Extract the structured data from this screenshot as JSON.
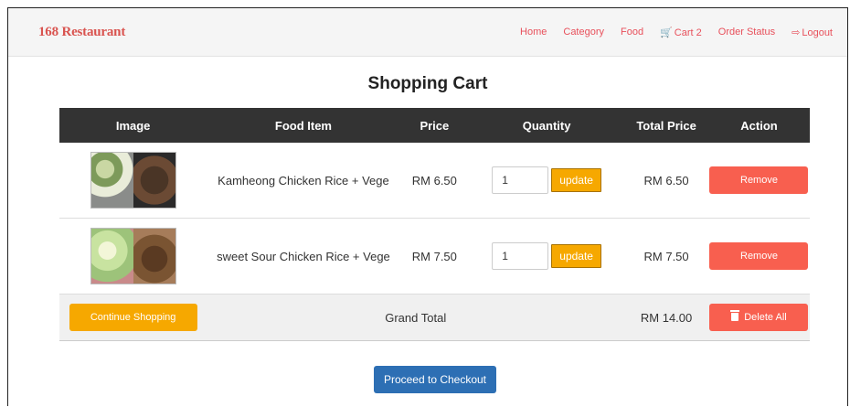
{
  "nav": {
    "brand": "168 Restaurant",
    "links": [
      "Home",
      "Category",
      "Food",
      "Cart 2",
      "Order Status",
      "Logout"
    ]
  },
  "page": {
    "title": "Shopping Cart"
  },
  "table": {
    "headers": [
      "Image",
      "Food Item",
      "Price",
      "Quantity",
      "Total Price",
      "Action"
    ],
    "rows": [
      {
        "food": "Kamheong Chicken Rice + Vege",
        "price": "RM 6.50",
        "qty": "1",
        "update_label": "update",
        "total": "RM 6.50",
        "remove_label": "Remove"
      },
      {
        "food": "sweet Sour Chicken Rice + Vege",
        "price": "RM 7.50",
        "qty": "1",
        "update_label": "update",
        "total": "RM 7.50",
        "remove_label": "Remove"
      }
    ],
    "footer": {
      "continue_label": "Continue Shopping",
      "grand_total_label": "Grand Total",
      "grand_total_value": "RM 14.00",
      "delete_all_label": "Delete All"
    }
  },
  "checkout": {
    "label": "Proceed to Checkout"
  },
  "colors": {
    "accent": "#e8505b",
    "orange": "#f6a800",
    "red": "#f85f4f",
    "blue": "#2d6fb4",
    "header_dark": "#333333"
  }
}
